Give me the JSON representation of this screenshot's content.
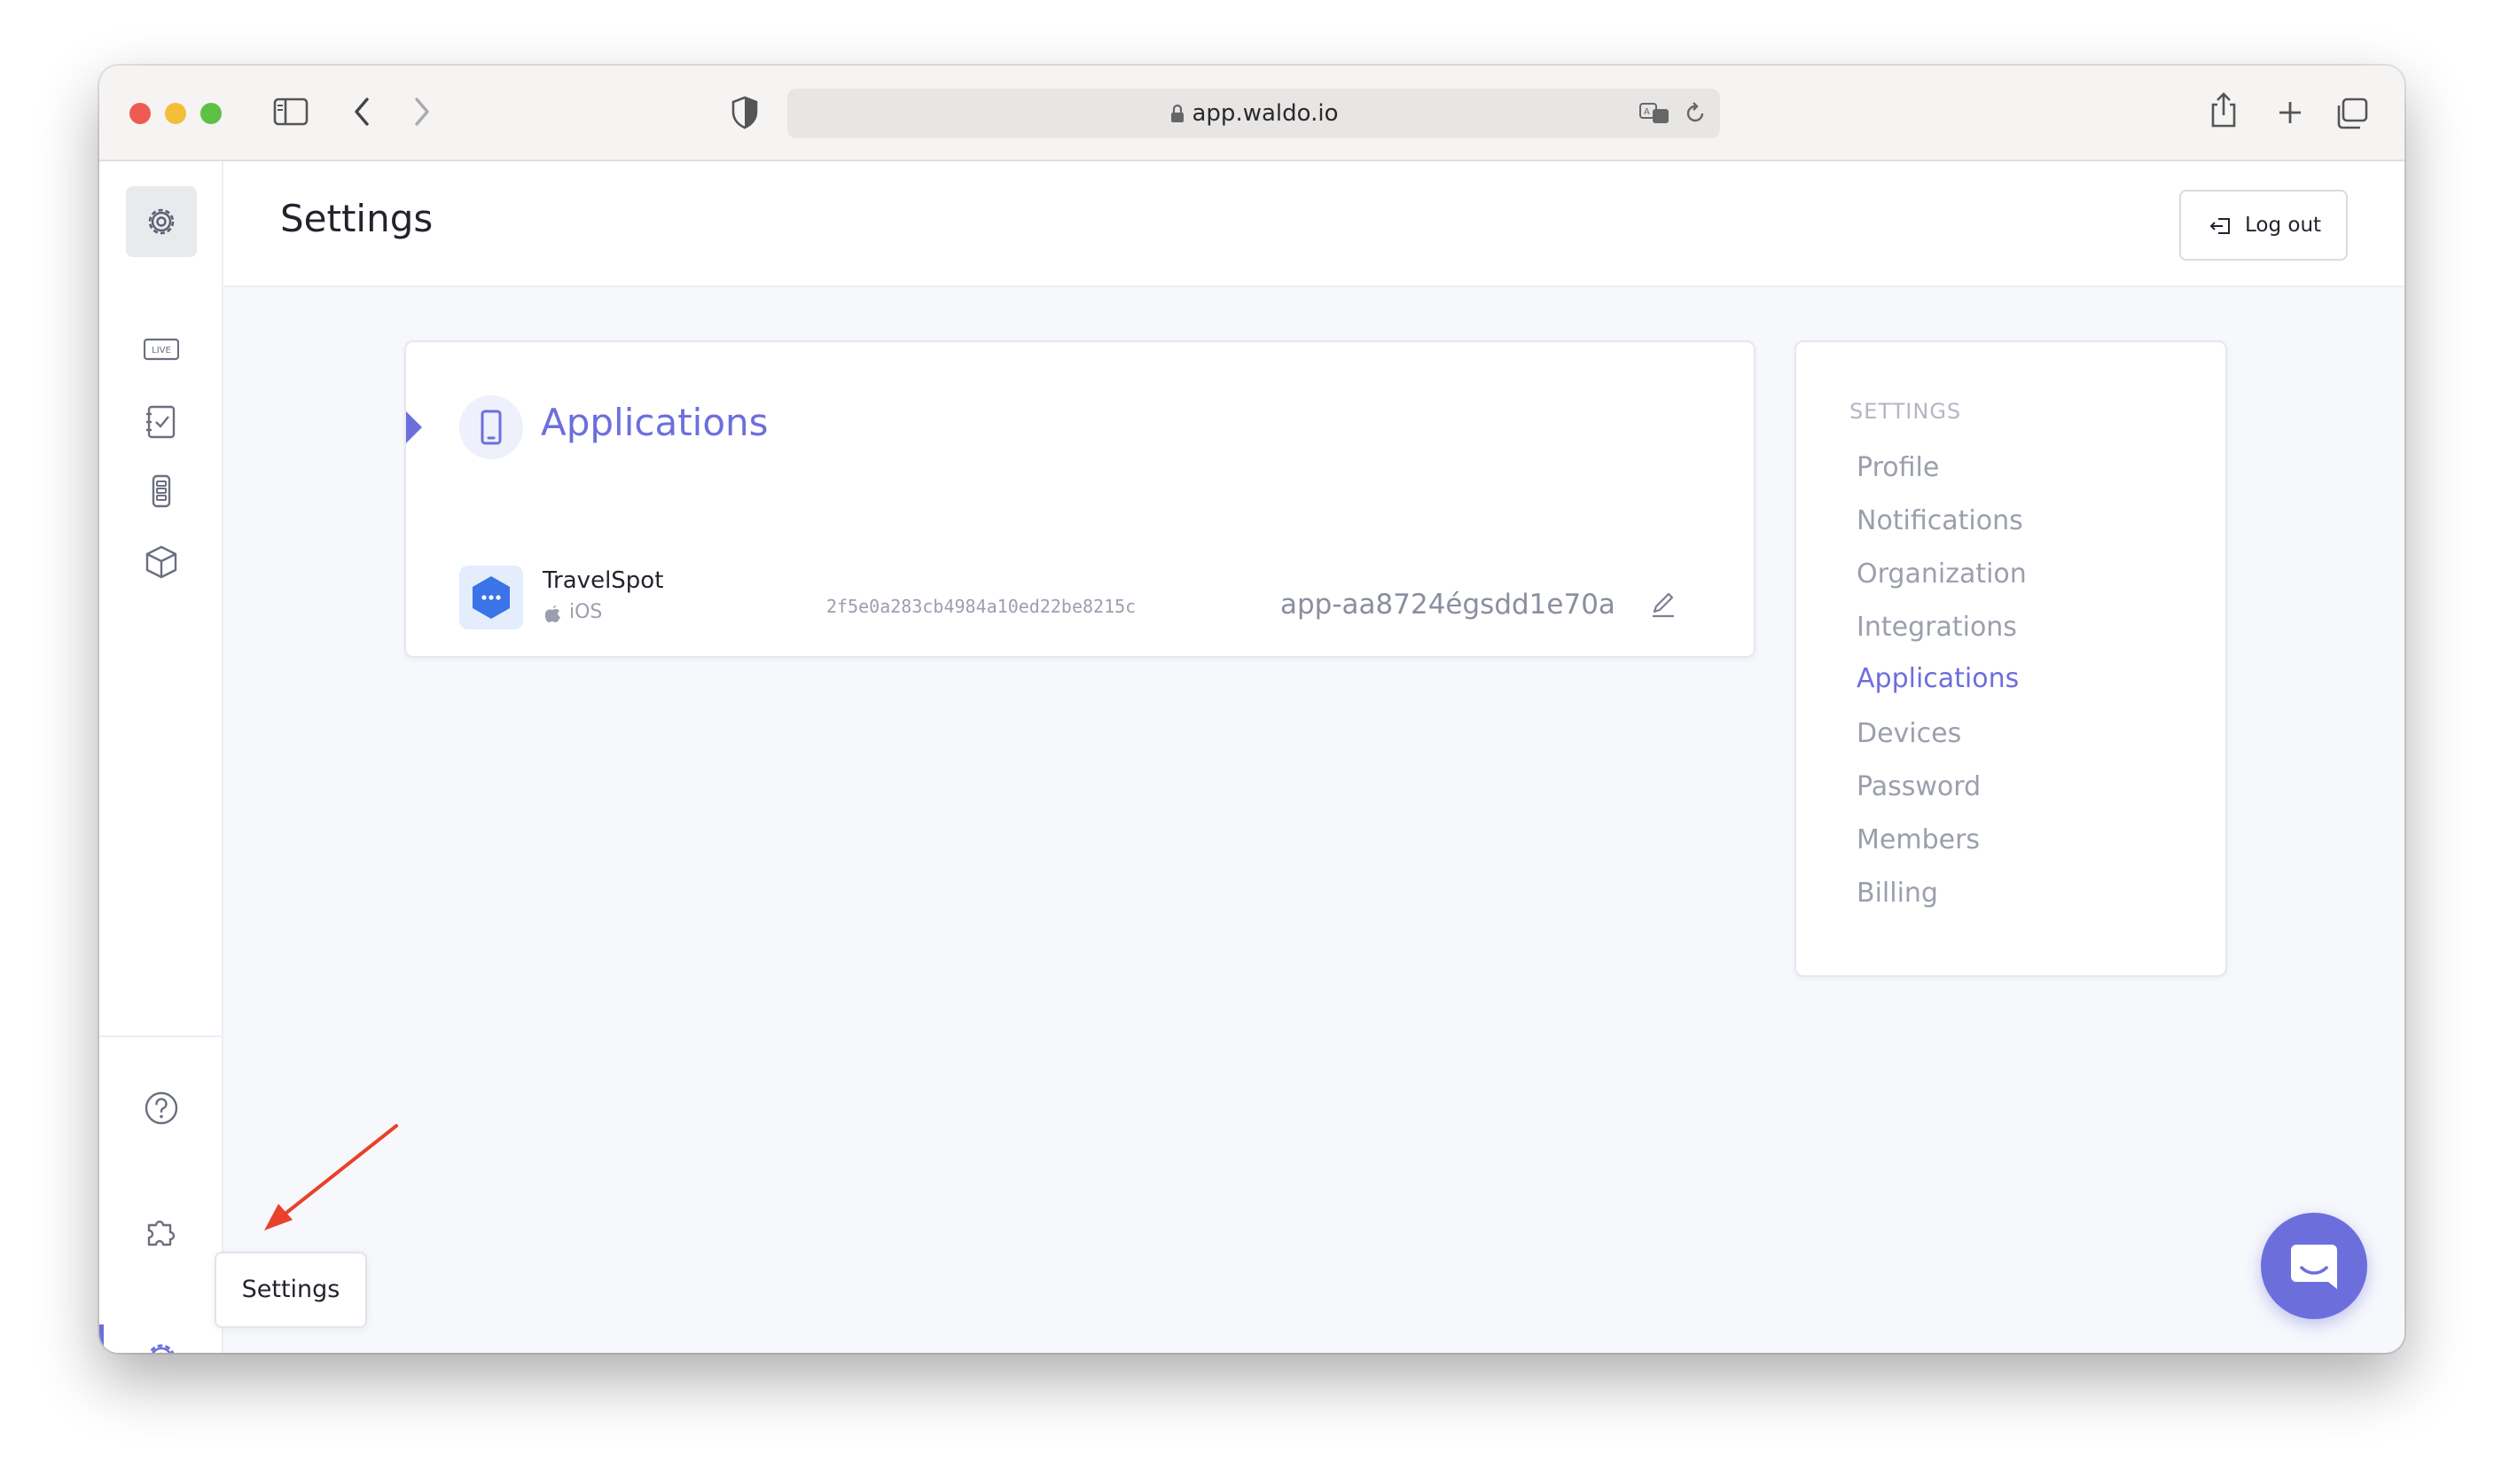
{
  "browser": {
    "url": "app.waldo.io"
  },
  "header": {
    "title": "Settings",
    "logout_label": "Log out"
  },
  "sidebar": {
    "items": [
      {
        "name": "settings-icon",
        "active": true
      },
      {
        "name": "live-icon",
        "label": "LIVE"
      },
      {
        "name": "checklist-icon"
      },
      {
        "name": "devices-icon"
      },
      {
        "name": "box-icon"
      },
      {
        "name": "help-icon"
      },
      {
        "name": "puzzle-icon"
      },
      {
        "name": "settings-gear-icon"
      }
    ],
    "tooltip": "Settings"
  },
  "applications": {
    "title": "Applications",
    "apps": [
      {
        "name": "TravelSpot",
        "platform": "iOS",
        "hash": "2f5e0a283cb4984a10ed22be8215c",
        "app_id": "app-aa8724égsdd1e70a"
      }
    ]
  },
  "settings_nav": {
    "heading": "SETTINGS",
    "items": [
      "Profile",
      "Notifications",
      "Organization",
      "Integrations",
      "Applications",
      "Devices",
      "Password",
      "Members",
      "Billing"
    ],
    "active": "Applications"
  },
  "colors": {
    "accent": "#6c6fdb",
    "app_logo": "#3b73e8",
    "annotation_arrow": "#e8412c"
  }
}
